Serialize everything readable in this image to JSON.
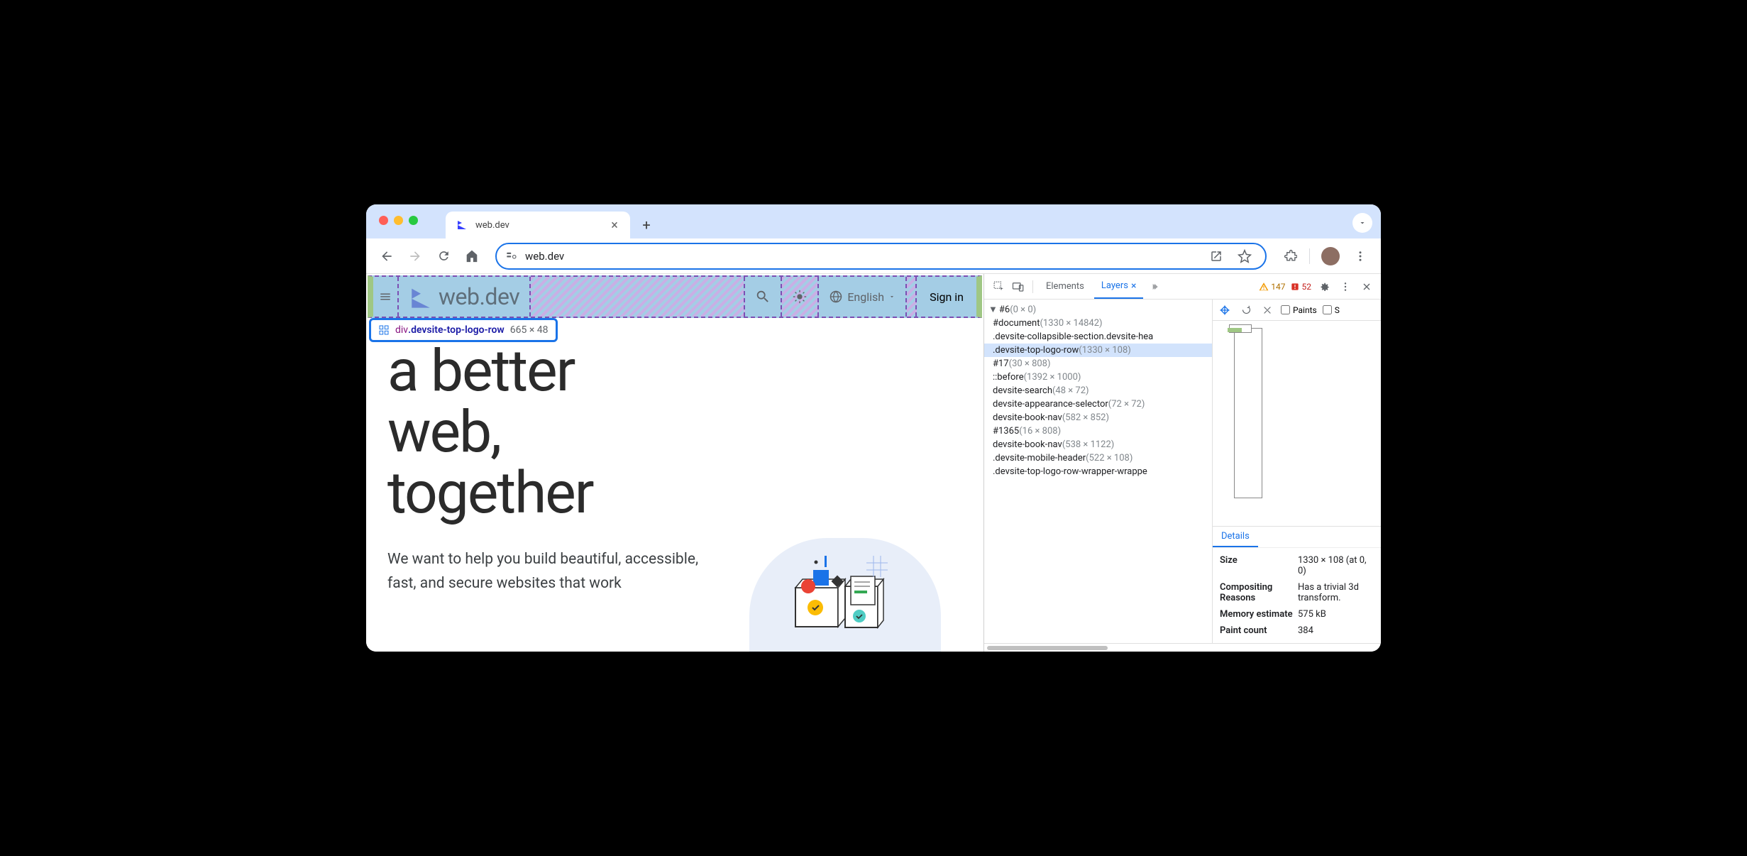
{
  "browser": {
    "tab_title": "web.dev",
    "url": "web.dev"
  },
  "page": {
    "header": {
      "logo_text": "web.dev",
      "language": "English",
      "sign_in": "Sign in"
    },
    "inspector_tooltip": {
      "tag": "div",
      "class": ".devsite-top-logo-row",
      "dims": "665 × 48"
    },
    "hero": {
      "title_line1": "a better",
      "title_line2": "web,",
      "title_line3": "together",
      "desc": "We want to help you build beautiful, accessible, fast, and secure websites that work"
    }
  },
  "devtools": {
    "tabs": {
      "elements": "Elements",
      "layers": "Layers"
    },
    "badges": {
      "warnings": "147",
      "errors": "52"
    },
    "layers": [
      {
        "level": 0,
        "name": "#6",
        "dims": "(0 × 0)",
        "arrow": true
      },
      {
        "level": 1,
        "name": "#document",
        "dims": "(1330 × 14842)"
      },
      {
        "level": 1,
        "name": ".devsite-collapsible-section.devsite-hea",
        "dims": ""
      },
      {
        "level": 1,
        "name": ".devsite-top-logo-row",
        "dims": "(1330 × 108)",
        "selected": true
      },
      {
        "level": 1,
        "name": "#17",
        "dims": "(30 × 808)"
      },
      {
        "level": 1,
        "name": "::before",
        "dims": "(1392 × 1000)"
      },
      {
        "level": 1,
        "name": "devsite-search",
        "dims": "(48 × 72)"
      },
      {
        "level": 1,
        "name": "devsite-appearance-selector",
        "dims": "(72 × 72)"
      },
      {
        "level": 1,
        "name": "devsite-book-nav",
        "dims": "(582 × 852)"
      },
      {
        "level": 1,
        "name": "#1365",
        "dims": "(16 × 808)"
      },
      {
        "level": 1,
        "name": "devsite-book-nav",
        "dims": "(538 × 1122)"
      },
      {
        "level": 1,
        "name": ".devsite-mobile-header",
        "dims": "(522 × 108)"
      },
      {
        "level": 1,
        "name": ".devsite-top-logo-row-wrapper-wrappe",
        "dims": ""
      }
    ],
    "canvas_tools": {
      "paints": "Paints",
      "s": "S"
    },
    "details": {
      "tab": "Details",
      "rows": [
        {
          "label": "Size",
          "value": "1330 × 108 (at 0, 0)"
        },
        {
          "label": "Compositing Reasons",
          "value": "Has a trivial 3d transform."
        },
        {
          "label": "Memory estimate",
          "value": "575 kB"
        },
        {
          "label": "Paint count",
          "value": "384"
        }
      ]
    }
  }
}
